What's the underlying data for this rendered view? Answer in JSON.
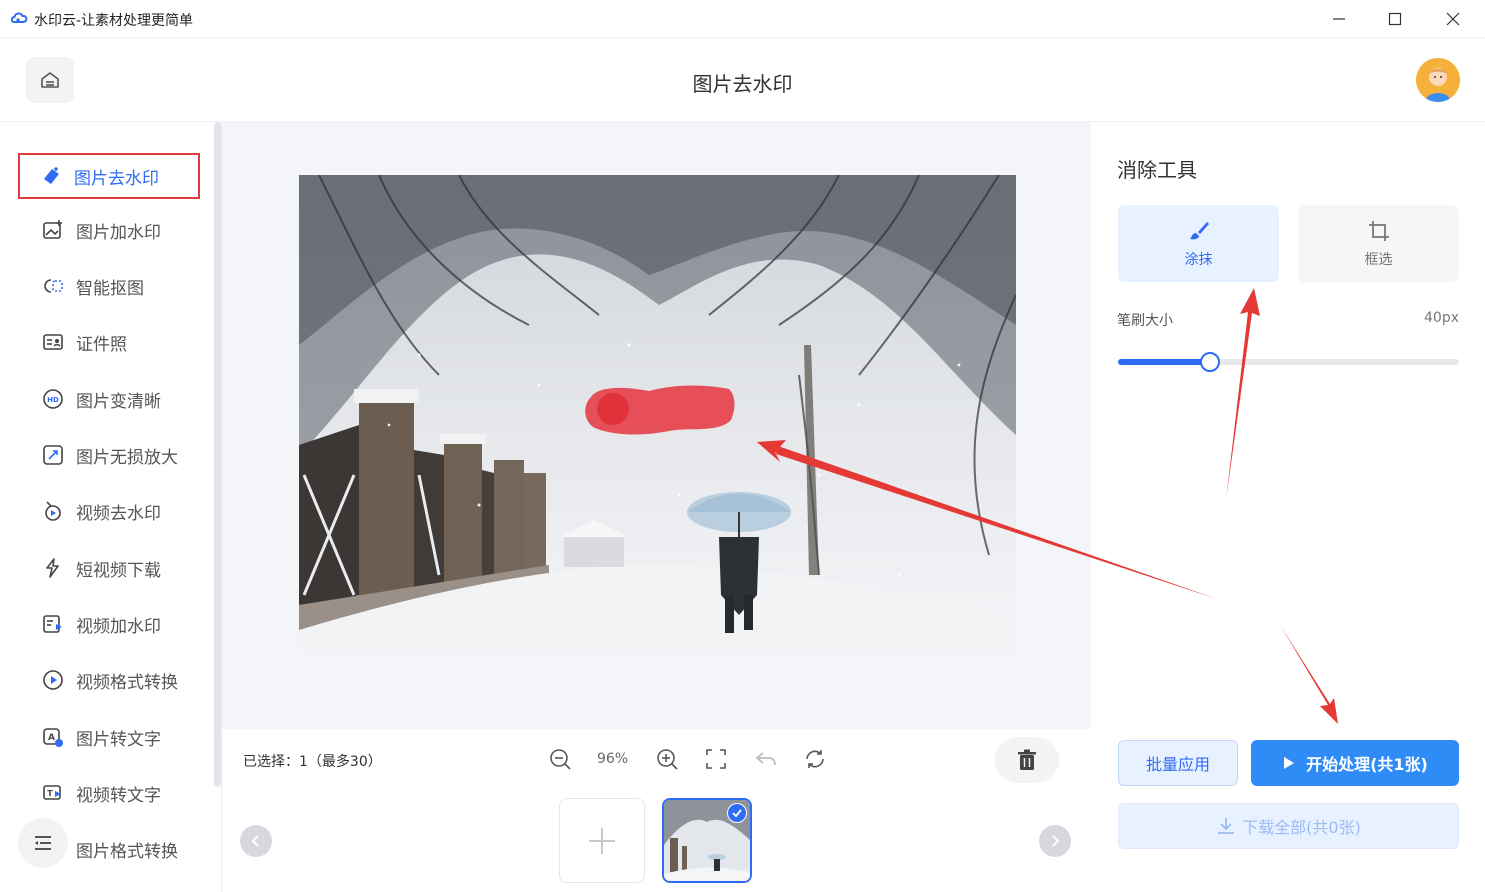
{
  "window": {
    "title": "水印云-让素材处理更简单",
    "minimize_icon": "minimize-icon",
    "maximize_icon": "maximize-icon",
    "close_icon": "close-icon"
  },
  "header": {
    "title": "图片去水印",
    "home_icon": "home-icon"
  },
  "sidebar": {
    "items": [
      {
        "label": "图片去水印",
        "icon": "eraser-icon"
      },
      {
        "label": "图片加水印",
        "icon": "image-add-icon"
      },
      {
        "label": "智能抠图",
        "icon": "cutout-icon"
      },
      {
        "label": "证件照",
        "icon": "id-photo-icon"
      },
      {
        "label": "图片变清晰",
        "icon": "hd-icon"
      },
      {
        "label": "图片无损放大",
        "icon": "enlarge-icon"
      },
      {
        "label": "视频去水印",
        "icon": "video-eraser-icon"
      },
      {
        "label": "短视频下载",
        "icon": "download-video-icon"
      },
      {
        "label": "视频加水印",
        "icon": "video-add-icon"
      },
      {
        "label": "视频格式转换",
        "icon": "play-circle-icon"
      },
      {
        "label": "图片转文字",
        "icon": "image-text-icon"
      },
      {
        "label": "视频转文字",
        "icon": "video-text-icon"
      },
      {
        "label": "图片格式转换",
        "icon": "image-format-icon"
      }
    ],
    "active_index": 0
  },
  "toolbar": {
    "selection_info": "已选择：1（最多30）",
    "zoom": "96%"
  },
  "panel": {
    "title": "消除工具",
    "tools": [
      {
        "label": "涂抹",
        "icon": "brush-icon"
      },
      {
        "label": "框选",
        "icon": "crop-icon"
      }
    ],
    "brush_size_label": "笔刷大小",
    "brush_size_value": "40px",
    "brush_slider_fraction": 0.27,
    "batch_apply_label": "批量应用",
    "start_label": "开始处理(共1张)",
    "download_label": "下载全部(共0张)"
  },
  "colors": {
    "accent": "#2f6cf6",
    "start_button": "#2f8cf6",
    "highlight_box": "#e23b3b",
    "annotation_arrow": "#e53935"
  }
}
